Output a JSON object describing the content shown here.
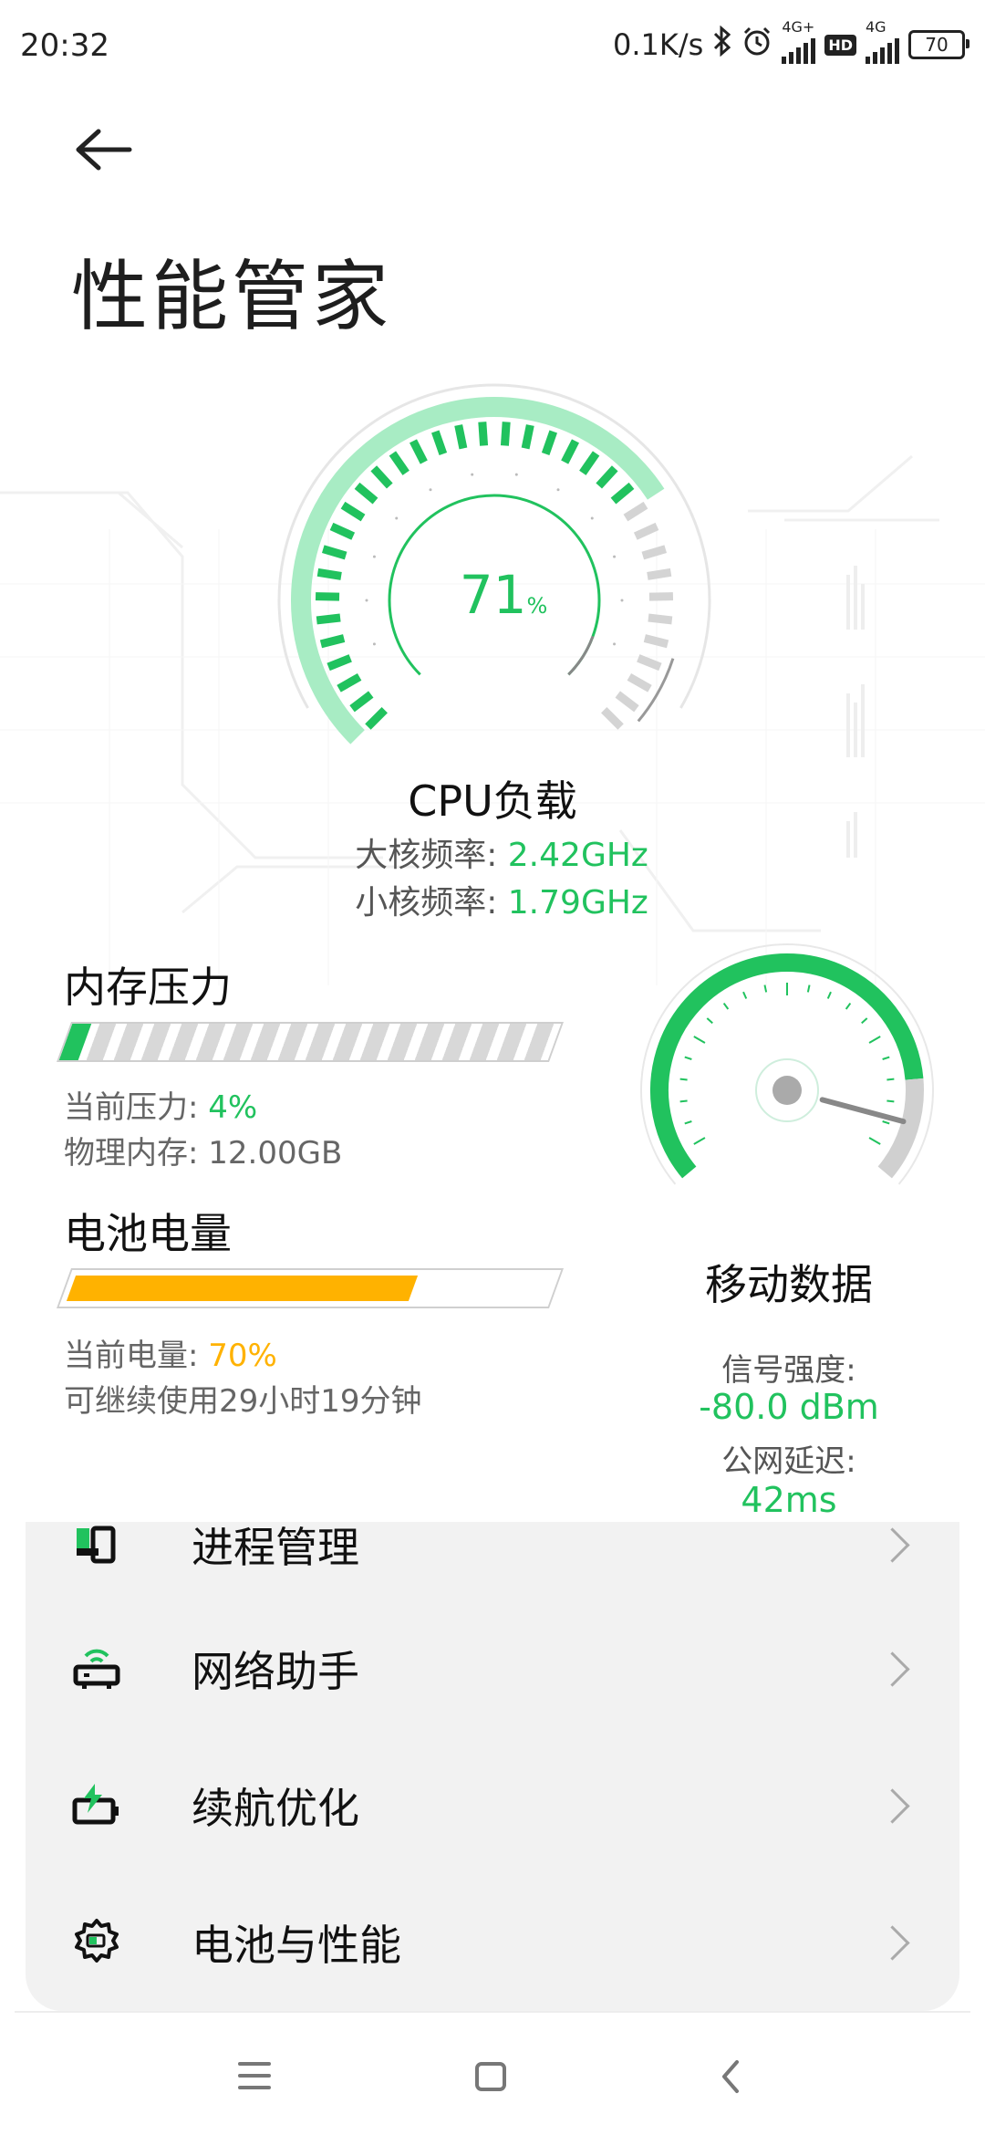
{
  "status_bar": {
    "time": "20:32",
    "speed": "0.1K/s",
    "net1": "4G+",
    "hd": "HD",
    "net2": "4G",
    "battery": "70"
  },
  "page": {
    "title": "性能管家"
  },
  "cpu": {
    "percent": "71",
    "percent_unit": "%",
    "label": "CPU负载",
    "big_core_label": "大核频率:",
    "big_core_value": "2.42GHz",
    "small_core_label": "小核频率:",
    "small_core_value": "1.79GHz",
    "load_fraction": 0.71
  },
  "memory": {
    "title": "内存压力",
    "pressure_label": "当前压力:",
    "pressure_value": "4%",
    "physical_label": "物理内存:",
    "physical_value": "12.00GB",
    "fraction": 0.04
  },
  "battery": {
    "title": "电池电量",
    "level_label": "当前电量:",
    "level_value": "70%",
    "remaining": "可继续使用29小时19分钟",
    "fraction": 0.7
  },
  "mobile_data": {
    "title": "移动数据",
    "signal_label": "信号强度:",
    "signal_value": "-80.0 dBm",
    "latency_label": "公网延迟:",
    "latency_value": "42ms"
  },
  "menu": {
    "items": [
      {
        "label": "进程管理",
        "icon": "process-icon"
      },
      {
        "label": "网络助手",
        "icon": "router-icon"
      },
      {
        "label": "续航优化",
        "icon": "battery-boost-icon"
      },
      {
        "label": "电池与性能",
        "icon": "gear-battery-icon"
      }
    ]
  },
  "colors": {
    "accent": "#21c25e",
    "battery": "#ffb200"
  }
}
